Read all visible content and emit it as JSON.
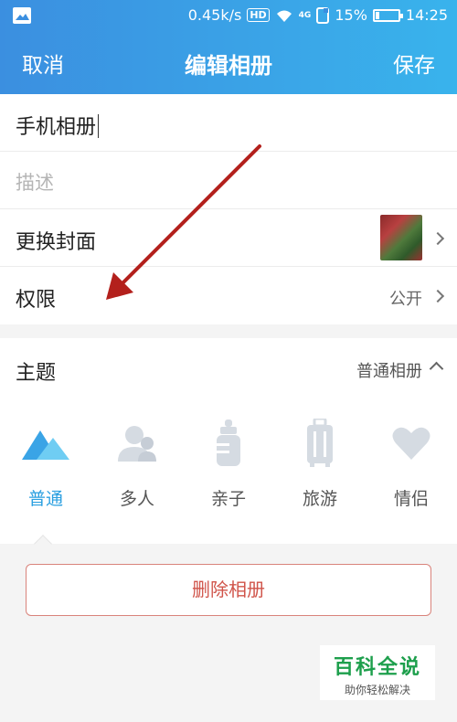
{
  "status_bar": {
    "speed": "0.45k/s",
    "hd": "HD",
    "network": "4G",
    "battery": "15%",
    "time": "14:25"
  },
  "nav": {
    "cancel": "取消",
    "title": "编辑相册",
    "save": "保存"
  },
  "form": {
    "album_name": "手机相册",
    "description_placeholder": "描述",
    "cover_label": "更换封面",
    "permission_label": "权限",
    "permission_value": "公开"
  },
  "theme": {
    "label": "主题",
    "selected": "普通相册",
    "options": [
      {
        "label": "普通",
        "icon": "mountain-icon",
        "active": true
      },
      {
        "label": "多人",
        "icon": "people-icon",
        "active": false
      },
      {
        "label": "亲子",
        "icon": "baby-bottle-icon",
        "active": false
      },
      {
        "label": "旅游",
        "icon": "luggage-icon",
        "active": false
      },
      {
        "label": "情侣",
        "icon": "heart-icon",
        "active": false
      }
    ]
  },
  "delete_label": "删除相册",
  "watermark": {
    "title": "百科全说",
    "subtitle": "助你轻松解决"
  },
  "colors": {
    "header_start": "#3b8fe0",
    "header_end": "#39b3ec",
    "accent": "#2a9fe0",
    "delete": "#d0544a",
    "arrow": "#b3201c"
  }
}
